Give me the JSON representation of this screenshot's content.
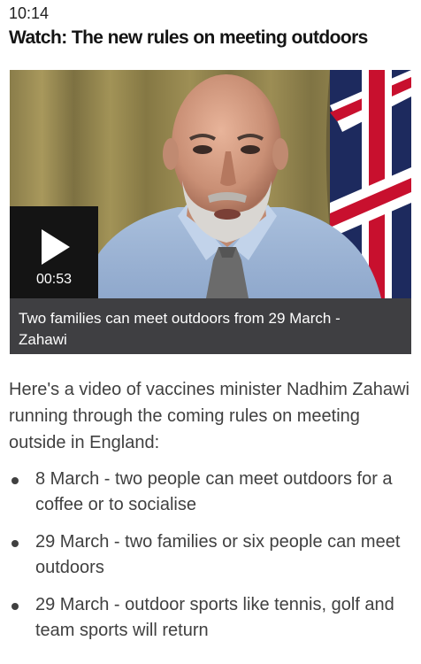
{
  "status_bar": {
    "time": "10:14"
  },
  "article": {
    "headline": "Watch: The new rules on meeting outdoors",
    "video": {
      "duration": "00:53",
      "caption": "Two families can meet outdoors from 29 March - Zahawi",
      "play_icon": "play-icon"
    },
    "intro": "Here's a video of vaccines minister Nadhim Zahawi running through the coming rules on meeting outside in England:",
    "bullets": [
      "8 March - two people can meet outdoors for a coffee or to socialise",
      "29 March - two families or six people can meet outdoors",
      "29 March - outdoor sports like tennis, golf and team sports will return"
    ]
  }
}
